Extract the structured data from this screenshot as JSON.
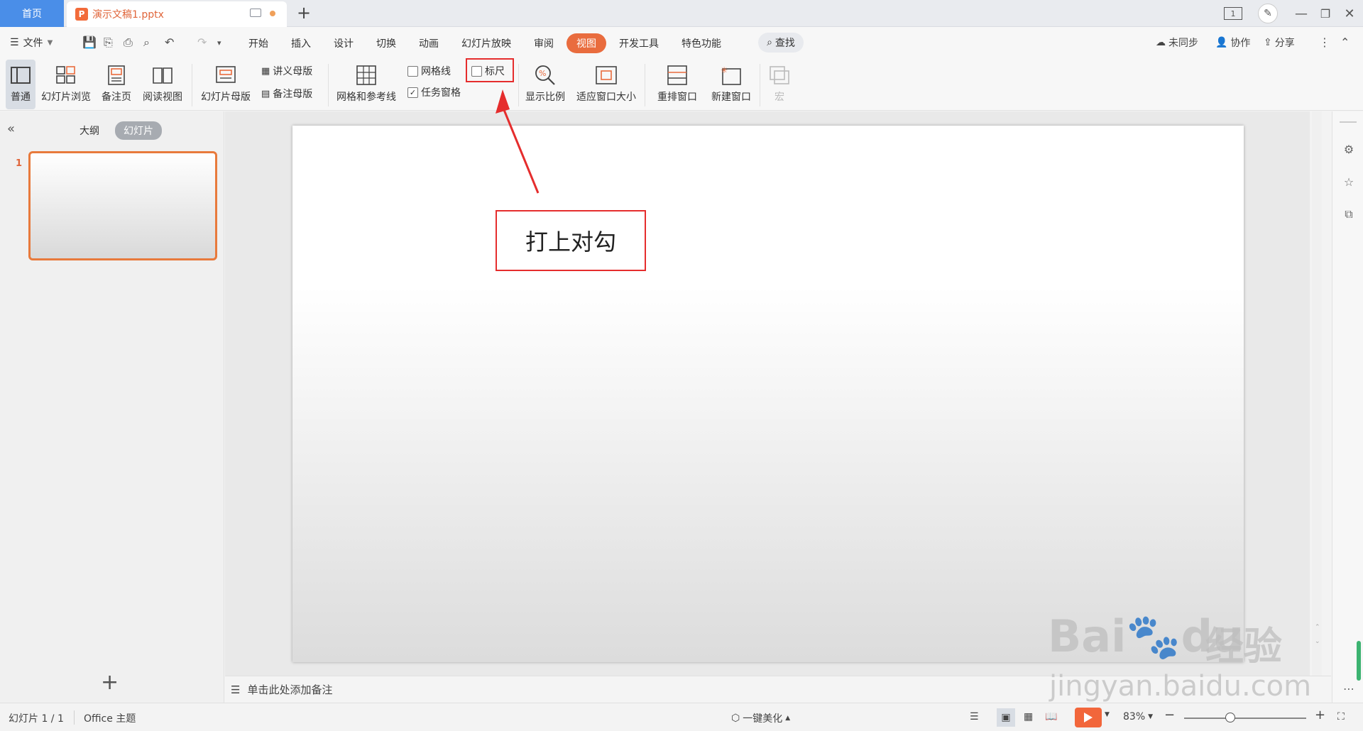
{
  "titlebar": {
    "home_tab": "首页",
    "doc_tab": "演示文稿1.pptx",
    "doc_icon_letter": "P",
    "add_tab": "+",
    "page_badge": "1"
  },
  "menubar": {
    "file_label": "文件",
    "tabs": [
      "开始",
      "插入",
      "设计",
      "切换",
      "动画",
      "幻灯片放映",
      "审阅",
      "视图",
      "开发工具",
      "特色功能"
    ],
    "active_tab": "视图",
    "search_label": "查找",
    "sync_label": "未同步",
    "collab_label": "协作",
    "share_label": "分享"
  },
  "ribbon": {
    "normal": "普通",
    "slide_browse": "幻灯片浏览",
    "notes_page": "备注页",
    "reading_view": "阅读视图",
    "slide_master": "幻灯片母版",
    "handout_master": "讲义母版",
    "notes_master": "备注母版",
    "grid_guides": "网格和参考线",
    "gridlines": "网格线",
    "gridlines_checked": false,
    "ruler": "标尺",
    "ruler_checked": false,
    "task_pane": "任务窗格",
    "task_pane_checked": true,
    "zoom": "显示比例",
    "fit_window": "适应窗口大小",
    "arrange_windows": "重排窗口",
    "new_window": "新建窗口",
    "macro": "宏"
  },
  "leftpanel": {
    "outline_tab": "大纲",
    "slides_tab": "幻灯片",
    "slide_number": "1",
    "add_slide": "+"
  },
  "notes": {
    "placeholder": "单击此处添加备注"
  },
  "annotation": {
    "text": "打上对勾",
    "color": "#e52d2d"
  },
  "statusbar": {
    "slide_info": "幻灯片 1 / 1",
    "theme": "Office 主题",
    "beautify": "一键美化",
    "zoom": "83%",
    "zoom_level": 0.83
  },
  "watermark": {
    "line1": "Bai",
    "line1b": "du",
    "cn": "经验",
    "url": "jingyan.baidu.com"
  },
  "colors": {
    "accent": "#e96c3e",
    "home_tab": "#4a8ee8",
    "highlight": "#e52d2d"
  }
}
